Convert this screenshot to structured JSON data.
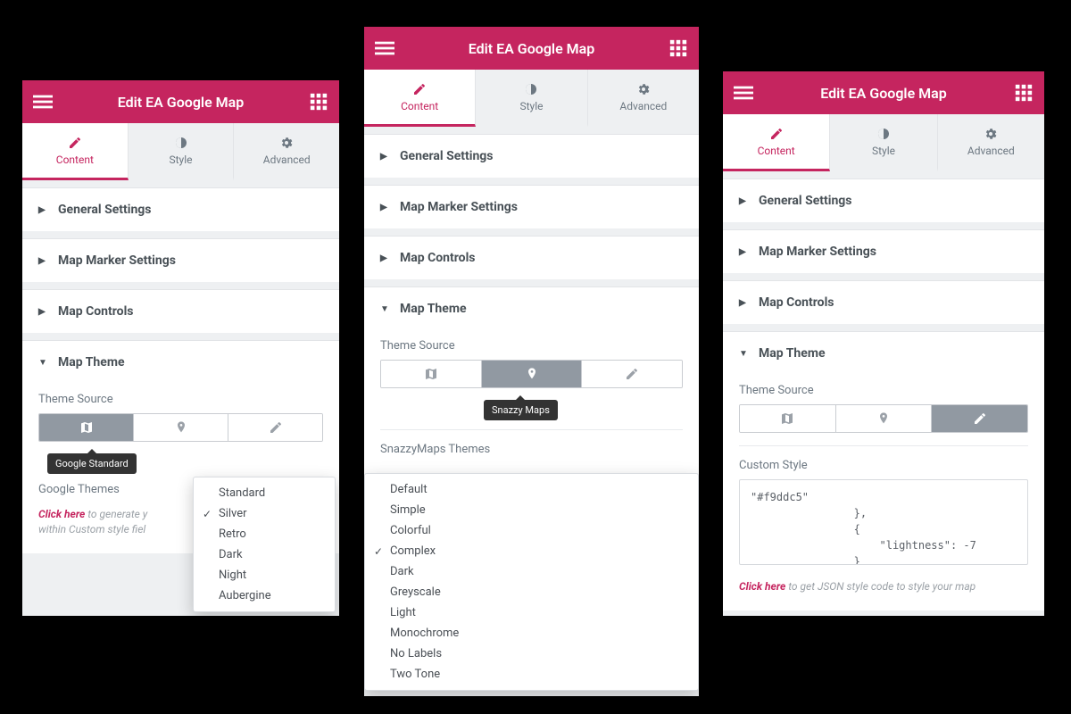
{
  "header": {
    "title": "Edit EA Google Map"
  },
  "tabs": {
    "content": "Content",
    "style": "Style",
    "advanced": "Advanced"
  },
  "sections": {
    "general": "General Settings",
    "marker": "Map Marker Settings",
    "controls": "Map Controls",
    "theme": "Map Theme"
  },
  "panel1": {
    "theme_source_label": "Theme Source",
    "tooltip": "Google Standard",
    "google_themes_label": "Google Themes",
    "hint_link": "Click here",
    "hint_rest": " to generate y",
    "hint_line2": "within Custom style fiel",
    "dropdown": [
      "Standard",
      "Silver",
      "Retro",
      "Dark",
      "Night",
      "Aubergine"
    ],
    "dropdown_selected": "Silver"
  },
  "panel2": {
    "theme_source_label": "Theme Source",
    "tooltip": "Snazzy Maps",
    "snazzy_label": "SnazzyMaps Themes",
    "dropdown": [
      "Default",
      "Simple",
      "Colorful",
      "Complex",
      "Dark",
      "Greyscale",
      "Light",
      "Monochrome",
      "No Labels",
      "Two Tone"
    ],
    "dropdown_selected": "Complex"
  },
  "panel3": {
    "theme_source_label": "Theme Source",
    "custom_style_label": "Custom Style",
    "code": "\"#f9ddc5\"\n                },\n                {\n                    \"lightness\": -7\n                }",
    "hint_link": "Click here",
    "hint_rest": " to get JSON style code to style your map"
  }
}
